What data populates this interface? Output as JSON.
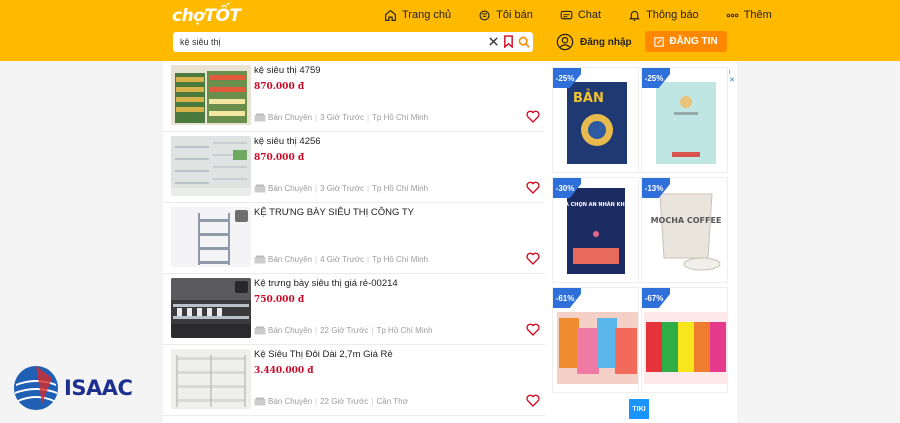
{
  "header": {
    "logo": "chợTỐT",
    "nav": [
      {
        "label": "Trang chủ",
        "icon": "home-icon"
      },
      {
        "label": "Tôi bán",
        "icon": "seller-icon"
      },
      {
        "label": "Chat",
        "icon": "chat-icon"
      },
      {
        "label": "Thông báo",
        "icon": "bell-icon"
      },
      {
        "label": "Thêm",
        "icon": "more-icon"
      }
    ],
    "search": {
      "value": "kệ siêu thị"
    },
    "login_label": "Đăng nhập",
    "post_label": "ĐĂNG TIN"
  },
  "listings": [
    {
      "title": "kệ siêu thị 4759",
      "price": "870.000 đ",
      "seller": "Bán Chuyên",
      "time": "3 Giờ Trước",
      "location": "Tp Hồ Chí Minh"
    },
    {
      "title": "kệ siêu thị 4256",
      "price": "870.000 đ",
      "seller": "Bán Chuyên",
      "time": "3 Giờ Trước",
      "location": "Tp Hồ Chí Minh"
    },
    {
      "title": "KỆ TRƯNG BÀY SIÊU THỊ CÔNG TY",
      "price": "",
      "seller": "Bán Chuyên",
      "time": "4 Giờ Trước",
      "location": "Tp Hồ Chí Minh"
    },
    {
      "title": "Kệ trưng bày siêu thị giá rẻ-00214",
      "price": "750.000 đ",
      "seller": "Bán Chuyên",
      "time": "22 Giờ Trước",
      "location": "Tp Hồ Chí Minh"
    },
    {
      "title": "Kệ Siêu Thị Đôi Dài 2,7m Giá Rẻ",
      "price": "3.440.000 đ",
      "seller": "Bán Chuyên",
      "time": "22 Giờ Trước",
      "location": "Cần Thơ"
    }
  ],
  "ads": {
    "discounts": [
      "-25%",
      "-25%",
      "-30%",
      "-13%",
      "-61%",
      "-67%"
    ],
    "product_texts": {
      "book1": "BẢN",
      "book3": "ĐỪNG LỰA CHỌN AN NHÀN KHI CÒN TRẺ",
      "cup": "MOCHA COFFEE"
    },
    "info_label": "i ✕",
    "brand": "TIKI"
  },
  "watermark": {
    "text": "ISAAC"
  },
  "colors": {
    "header": "#ffba00",
    "post_button": "#ff8800",
    "price": "#c90927",
    "discount": "#2e6fd9"
  }
}
